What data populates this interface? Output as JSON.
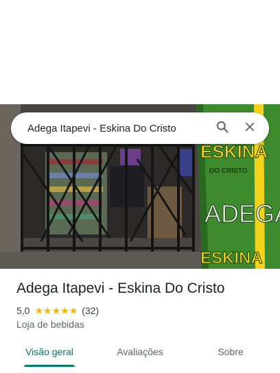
{
  "search": {
    "query": "Adega Itapevi - Eskina Do Cristo",
    "search_icon": "search-icon",
    "close_icon": "close-icon"
  },
  "photo": {
    "sign_text_top": "ESKINA",
    "sign_text_sub": "DO CRISTO",
    "sign_text_main": "ADEGA",
    "sign_text_bottom": "ESKINA",
    "colors": {
      "sign_green": "#3d8b2d",
      "sign_yellow": "#f2d21b",
      "gate_black": "#1c1c1c"
    }
  },
  "place": {
    "name": "Adega Itapevi - Eskina Do Cristo",
    "rating": "5,0",
    "star_count": 5,
    "review_count": "(32)",
    "category": "Loja de bebidas"
  },
  "tabs": [
    {
      "label": "Visão geral",
      "active": true
    },
    {
      "label": "Avaliações",
      "active": false
    },
    {
      "label": "Sobre",
      "active": false
    }
  ],
  "accent": "#00796b"
}
